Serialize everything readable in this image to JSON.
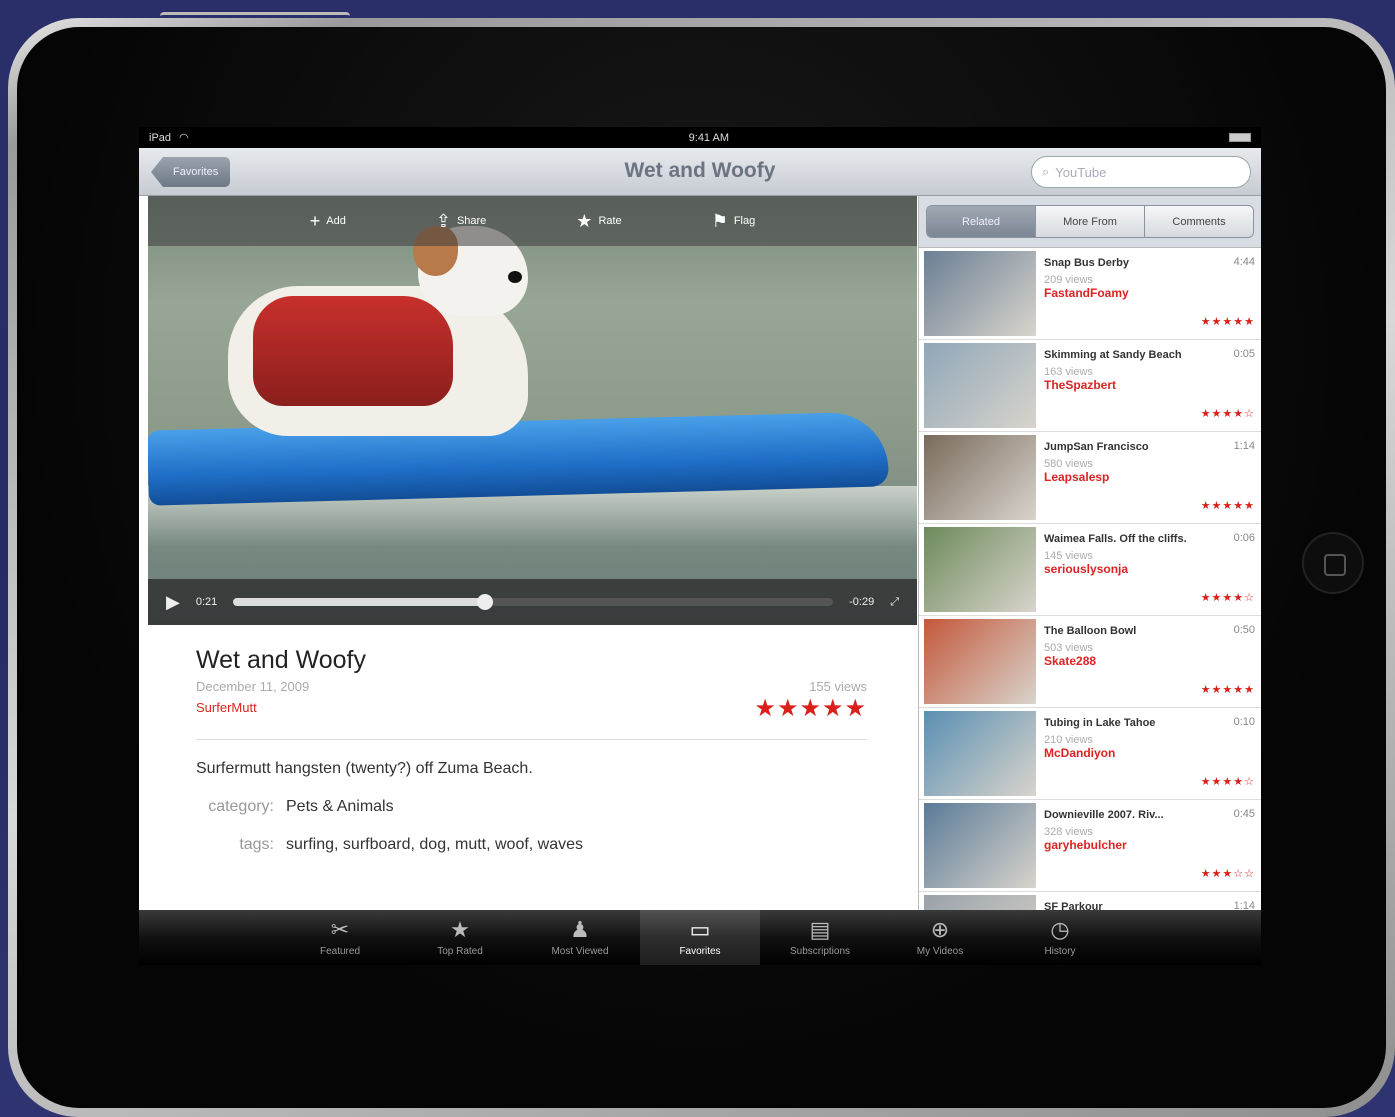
{
  "status_bar": {
    "device": "iPad",
    "time": "9:41 AM"
  },
  "nav": {
    "back_label": "Favorites",
    "title": "Wet and Woofy",
    "search_placeholder": "YouTube"
  },
  "video_toolbar": {
    "add_label": "Add",
    "share_label": "Share",
    "rate_label": "Rate",
    "flag_label": "Flag"
  },
  "player": {
    "elapsed": "0:21",
    "remaining": "-0:29",
    "progress": 0.42
  },
  "video_info": {
    "title": "Wet and Woofy",
    "date": "December 11, 2009",
    "author": "SurferMutt",
    "views": "155 views",
    "stars": "★★★★★",
    "description": "Surfermutt hangsten (twenty?) off Zuma Beach.",
    "category_label": "category:",
    "category_value": "Pets & Animals",
    "tags_label": "tags:",
    "tags_value": "surfing, surfboard, dog, mutt, woof, waves"
  },
  "segments": [
    "Related",
    "More From",
    "Comments"
  ],
  "related": [
    {
      "title": "Snap Bus Derby",
      "duration": "4:44",
      "views": "209 views",
      "user": "FastandFoamy",
      "stars": "★★★★★",
      "thumb": "#6b7f95"
    },
    {
      "title": "Skimming at Sandy Beach",
      "duration": "0:05",
      "views": "163 views",
      "user": "TheSpazbert",
      "stars": "★★★★☆",
      "thumb": "#8fa6b8"
    },
    {
      "title": "JumpSan Francisco",
      "duration": "1:14",
      "views": "580 views",
      "user": "Leapsalesp",
      "stars": "★★★★★",
      "thumb": "#7a6a5c"
    },
    {
      "title": "Waimea Falls. Off the cliffs.",
      "duration": "0:06",
      "views": "145 views",
      "user": "seriouslysonja",
      "stars": "★★★★☆",
      "thumb": "#6d8a5a"
    },
    {
      "title": "The Balloon Bowl",
      "duration": "0:50",
      "views": "503 views",
      "user": "Skate288",
      "stars": "★★★★★",
      "thumb": "#c4583a"
    },
    {
      "title": "Tubing in Lake Tahoe",
      "duration": "0:10",
      "views": "210 views",
      "user": "McDandiyon",
      "stars": "★★★★☆",
      "thumb": "#5a8fb2"
    },
    {
      "title": "Downieville 2007. Riv...",
      "duration": "0:45",
      "views": "328 views",
      "user": "garyhebulcher",
      "stars": "★★★☆☆",
      "thumb": "#5a7a98"
    },
    {
      "title": "SF Parkour",
      "duration": "1:14",
      "views": "",
      "user": "",
      "stars": "",
      "thumb": "#9aa2a8"
    }
  ],
  "tabs": [
    {
      "label": "Featured",
      "icon": "✂"
    },
    {
      "label": "Top Rated",
      "icon": "★"
    },
    {
      "label": "Most Viewed",
      "icon": "♟"
    },
    {
      "label": "Favorites",
      "icon": "▭"
    },
    {
      "label": "Subscriptions",
      "icon": "▤"
    },
    {
      "label": "My Videos",
      "icon": "⊕"
    },
    {
      "label": "History",
      "icon": "◷"
    }
  ],
  "active_tab": 3,
  "active_segment": 0
}
